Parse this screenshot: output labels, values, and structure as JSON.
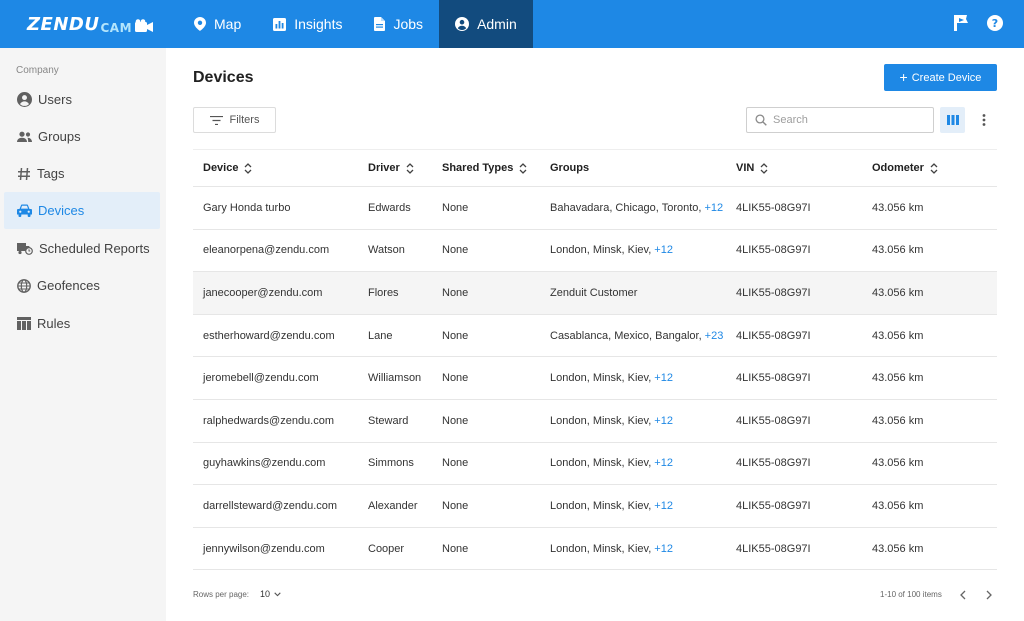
{
  "app": {
    "logo_main": "ZENDU",
    "logo_sub": "CAM"
  },
  "nav": [
    {
      "label": "Map",
      "icon": "map-pin-icon",
      "active": false
    },
    {
      "label": "Insights",
      "icon": "chart-icon",
      "active": false
    },
    {
      "label": "Jobs",
      "icon": "document-icon",
      "active": false
    },
    {
      "label": "Admin",
      "icon": "account-circle-icon",
      "active": true
    }
  ],
  "sidebar": {
    "section": "Company",
    "items": [
      {
        "label": "Users",
        "icon": "account-circle-icon"
      },
      {
        "label": "Groups",
        "icon": "people-icon"
      },
      {
        "label": "Tags",
        "icon": "hashtag-icon"
      },
      {
        "label": "Devices",
        "icon": "car-icon",
        "active": true
      },
      {
        "label": "Scheduled Reports",
        "icon": "truck-clock-icon"
      },
      {
        "label": "Geofences",
        "icon": "globe-icon"
      },
      {
        "label": "Rules",
        "icon": "table-icon"
      }
    ]
  },
  "page": {
    "title": "Devices",
    "create_button": "Create Device",
    "filters_label": "Filters",
    "search_placeholder": "Search"
  },
  "table": {
    "columns": [
      {
        "label": "Device",
        "sortable": true
      },
      {
        "label": "Driver",
        "sortable": true
      },
      {
        "label": "Shared Types",
        "sortable": true
      },
      {
        "label": "Groups",
        "sortable": false
      },
      {
        "label": "VIN",
        "sortable": true
      },
      {
        "label": "Odometer",
        "sortable": true
      }
    ],
    "rows": [
      {
        "device": "Gary Honda turbo",
        "driver": "Edwards",
        "shared": "None",
        "groups": "Bahavadara, Chicago, Toronto,",
        "more": "+12",
        "vin": "4LIK55-08G97I",
        "odometer": "43.056 km"
      },
      {
        "device": "eleanorpena@zendu.com",
        "driver": "Watson",
        "shared": "None",
        "groups": "London, Minsk, Kiev,",
        "more": "+12",
        "vin": "4LIK55-08G97I",
        "odometer": "43.056 km"
      },
      {
        "device": "janecooper@zendu.com",
        "driver": "Flores",
        "shared": "None",
        "groups": "Zenduit Customer",
        "more": "",
        "vin": "4LIK55-08G97I",
        "odometer": "43.056 km"
      },
      {
        "device": "estherhoward@zendu.com",
        "driver": "Lane",
        "shared": "None",
        "groups": "Casablanca, Mexico, Bangalor,",
        "more": "+23",
        "vin": "4LIK55-08G97I",
        "odometer": "43.056 km"
      },
      {
        "device": "jeromebell@zendu.com",
        "driver": "Williamson",
        "shared": "None",
        "groups": "London, Minsk, Kiev,",
        "more": "+12",
        "vin": "4LIK55-08G97I",
        "odometer": "43.056 km"
      },
      {
        "device": "ralphedwards@zendu.com",
        "driver": "Steward",
        "shared": "None",
        "groups": "London, Minsk, Kiev,",
        "more": "+12",
        "vin": "4LIK55-08G97I",
        "odometer": "43.056 km"
      },
      {
        "device": "guyhawkins@zendu.com",
        "driver": "Simmons",
        "shared": "None",
        "groups": "London, Minsk, Kiev,",
        "more": "+12",
        "vin": "4LIK55-08G97I",
        "odometer": "43.056 km"
      },
      {
        "device": "darrellsteward@zendu.com",
        "driver": "Alexander",
        "shared": "None",
        "groups": "London, Minsk, Kiev,",
        "more": "+12",
        "vin": "4LIK55-08G97I",
        "odometer": "43.056 km"
      },
      {
        "device": "jennywilson@zendu.com",
        "driver": "Cooper",
        "shared": "None",
        "groups": "London, Minsk, Kiev,",
        "more": "+12",
        "vin": "4LIK55-08G97I",
        "odometer": "43.056 km"
      }
    ]
  },
  "footer": {
    "rows_per_page_label": "Rows per page:",
    "rows_per_page_value": "10",
    "range": "1-10 of 100 items"
  },
  "colors": {
    "primary": "#1e88e5",
    "nav_active": "#124b7e",
    "sidebar_bg": "#f5f5f5",
    "sidebar_active_bg": "#e3eef9"
  }
}
